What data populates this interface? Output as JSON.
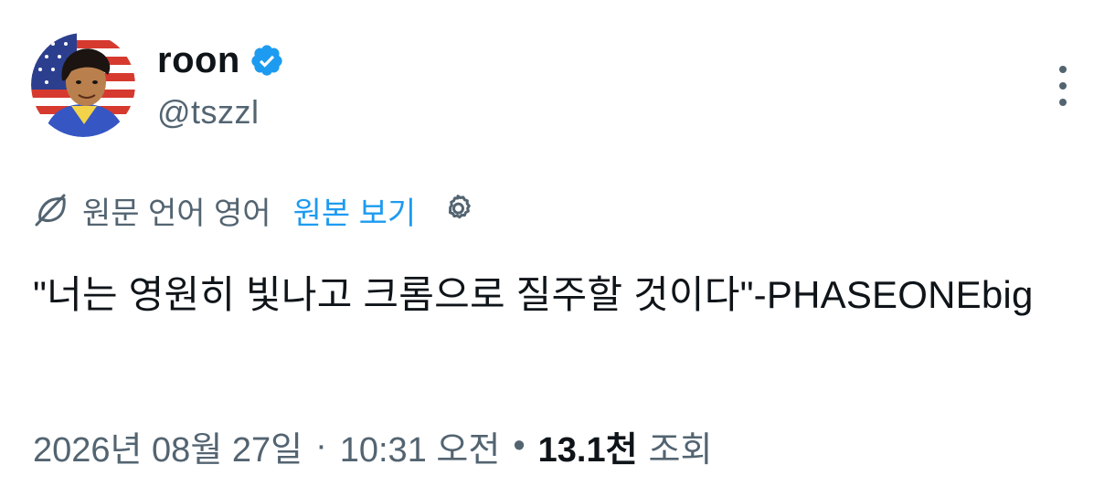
{
  "author": {
    "display_name": "roon",
    "handle": "@tszzl",
    "verified": true
  },
  "translation": {
    "source_language_text": "원문 언어 영어",
    "show_original_label": "원본 보기"
  },
  "tweet": {
    "text": "\"너는 영원히 빛나고 크롬으로 질주할 것이다\"-PHASEONEbig"
  },
  "meta": {
    "date": "2026년 08월 27일",
    "separator": "·",
    "time": "10:31 오전",
    "dot": "•",
    "views_count": "13.1천",
    "views_label": "조회"
  },
  "colors": {
    "text_primary": "#0f1419",
    "text_secondary": "#536471",
    "link_blue": "#1d9bf0",
    "verified_blue": "#1d9bf0"
  },
  "icons": [
    "avatar",
    "verified-badge-icon",
    "more-options-icon",
    "translate-icon",
    "settings-gear-icon"
  ]
}
